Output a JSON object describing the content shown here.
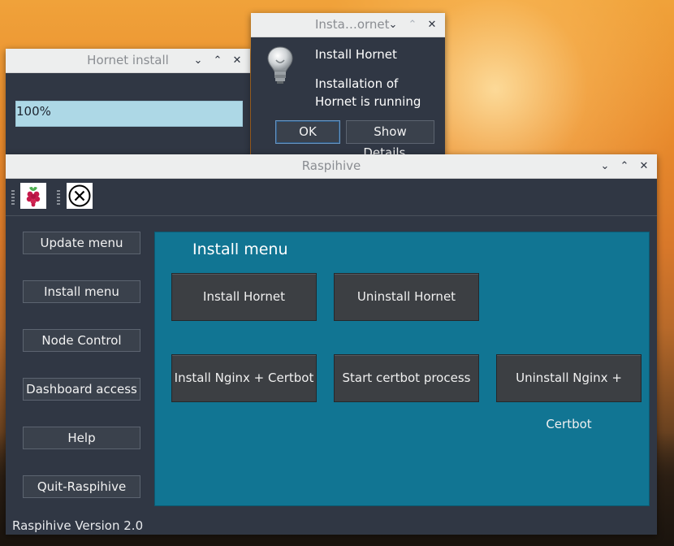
{
  "progress_window": {
    "title": "Hornet install",
    "progress_text": "100%",
    "progress_value": 1.0
  },
  "message_box": {
    "title": "Insta…ornet",
    "heading": "Install Hornet",
    "body": "Installation of Hornet is running",
    "ok_label": "OK",
    "details_label": "Show Details..."
  },
  "main_window": {
    "title": "Raspihive",
    "sidebar": {
      "items": [
        {
          "label": "Update menu"
        },
        {
          "label": "Install menu"
        },
        {
          "label": "Node Control"
        },
        {
          "label": "Dashboard access"
        },
        {
          "label": "Help"
        },
        {
          "label": "Quit-Raspihive"
        }
      ]
    },
    "panel": {
      "title": "Install menu",
      "buttons": [
        {
          "label": "Install Hornet"
        },
        {
          "label": "Uninstall Hornet"
        },
        {
          "label": "Install Nginx + Certbot"
        },
        {
          "label": "Start certbot process"
        },
        {
          "label": "Uninstall Nginx + Certbot"
        }
      ]
    },
    "version": "Raspihive Version 2.0"
  },
  "titlebar_buttons": {
    "minimize": "⌄",
    "maximize": "⌃",
    "close": "✕"
  },
  "colors": {
    "panel": "#117593",
    "progress": "#add8e6",
    "window_bg": "#303744"
  }
}
